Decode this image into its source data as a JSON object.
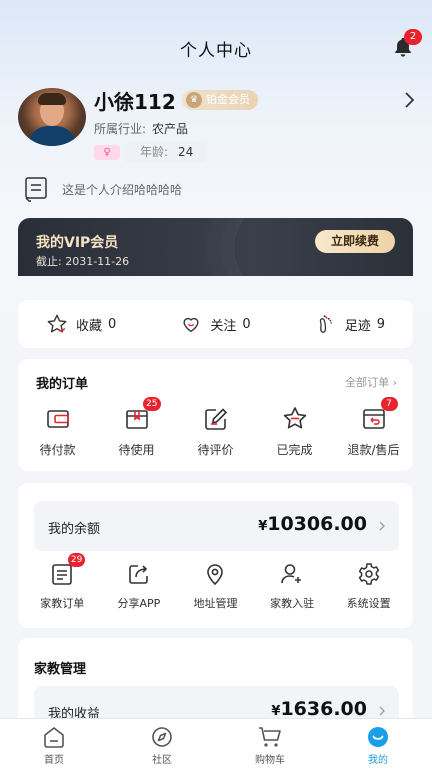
{
  "header": {
    "title": "个人中心",
    "notification_count": "2"
  },
  "profile": {
    "name": "小徐112",
    "member_level": "铂金会员",
    "industry_label": "所属行业:",
    "industry_value": "农产品",
    "gender_symbol": "♀",
    "age_label": "年龄:",
    "age_value": "24",
    "intro": "这是个人介绍哈哈哈哈"
  },
  "vip": {
    "title": "我的VIP会员",
    "expiry": "截止: 2031-11-26",
    "renew_label": "立即续费"
  },
  "stats": [
    {
      "label": "收藏",
      "value": "0",
      "icon": "star-icon"
    },
    {
      "label": "关注",
      "value": "0",
      "icon": "heart-icon"
    },
    {
      "label": "足迹",
      "value": "9",
      "icon": "footprint-icon"
    }
  ],
  "orders": {
    "title": "我的订单",
    "all_label": "全部订单",
    "items": [
      {
        "label": "待付款",
        "badge": ""
      },
      {
        "label": "待使用",
        "badge": "25"
      },
      {
        "label": "待评价",
        "badge": ""
      },
      {
        "label": "已完成",
        "badge": ""
      },
      {
        "label": "退款/售后",
        "badge": "7"
      }
    ]
  },
  "wallet": {
    "balance_label": "我的余额",
    "currency": "¥",
    "balance": "10306.00",
    "tools": [
      {
        "label": "家教订单",
        "badge": "29"
      },
      {
        "label": "分享APP",
        "badge": ""
      },
      {
        "label": "地址管理",
        "badge": ""
      },
      {
        "label": "家教入驻",
        "badge": ""
      },
      {
        "label": "系统设置",
        "badge": ""
      }
    ]
  },
  "tutor": {
    "title": "家教管理",
    "income_label": "我的收益",
    "currency": "¥",
    "income": "1636.00"
  },
  "tabbar": [
    {
      "label": "首页",
      "active": false
    },
    {
      "label": "社区",
      "active": false
    },
    {
      "label": "购物车",
      "active": false
    },
    {
      "label": "我的",
      "active": true
    }
  ],
  "colors": {
    "accent": "#1a9ee8",
    "badge": "#e8232d",
    "vip_gold": "#f5e2c0"
  }
}
